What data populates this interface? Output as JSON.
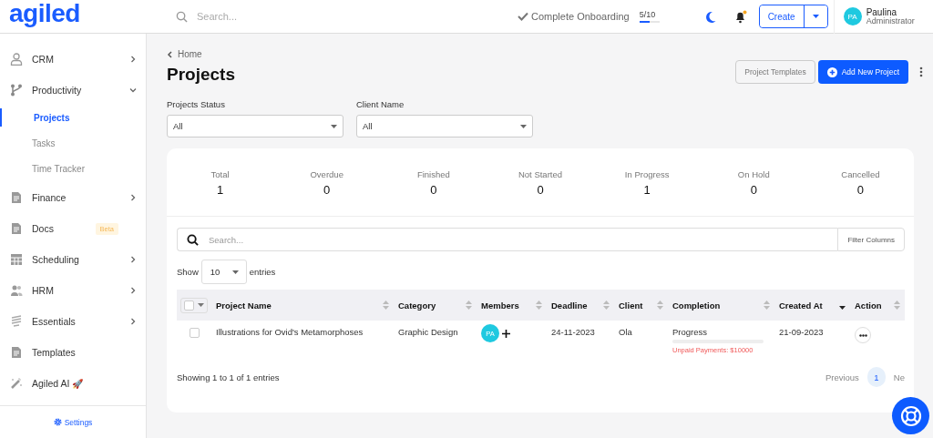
{
  "header": {
    "logo": "agiled",
    "search": {
      "placeholder": "Search..."
    },
    "onboarding": {
      "label": "Complete Onboarding",
      "count": "5/10",
      "level": 0.5
    },
    "notifications": {
      "unread": true
    },
    "create_button": "Create",
    "user": {
      "initials": "PA",
      "name": "Paulina",
      "role": "Administrator"
    }
  },
  "sidebar": {
    "items": [
      {
        "label": "CRM",
        "expanded": false,
        "selected": false
      },
      {
        "label": "Productivity",
        "expanded": true,
        "selected": false,
        "children": [
          {
            "label": "Projects",
            "selected": true
          },
          {
            "label": "Tasks",
            "selected": false
          },
          {
            "label": "Time Tracker",
            "selected": false
          }
        ]
      },
      {
        "label": "Finance",
        "expanded": false,
        "selected": false
      },
      {
        "label": "Docs",
        "badge": "Beta",
        "selected": false
      },
      {
        "label": "Scheduling",
        "expanded": false,
        "selected": false
      },
      {
        "label": "HRM",
        "expanded": false,
        "selected": false
      },
      {
        "label": "Essentials",
        "expanded": false,
        "selected": false
      },
      {
        "label": "Templates",
        "selected": false
      },
      {
        "label": "Agiled AI",
        "emoji": "🚀",
        "selected": false
      }
    ],
    "settings": "Settings"
  },
  "breadcrumb": "Home",
  "title": "Projects",
  "actions": {
    "templates": "Project Templates",
    "add": "Add New Project"
  },
  "filters": [
    {
      "label": "Projects Status",
      "value": "All"
    },
    {
      "label": "Client Name",
      "value": "All"
    }
  ],
  "stats": [
    {
      "label": "Total",
      "value": "1"
    },
    {
      "label": "Overdue",
      "value": "0"
    },
    {
      "label": "Finished",
      "value": "0"
    },
    {
      "label": "Not Started",
      "value": "0"
    },
    {
      "label": "In Progress",
      "value": "1"
    },
    {
      "label": "On Hold",
      "value": "0"
    },
    {
      "label": "Cancelled",
      "value": "0"
    }
  ],
  "table_search": {
    "placeholder": "Search..."
  },
  "filter_columns": "Filter Columns",
  "select_all": {
    "checked": false
  },
  "page_size": {
    "before": "Show",
    "value": "10",
    "after": "entries"
  },
  "table": {
    "columns": [
      {
        "label": "Project Name",
        "sorted": false
      },
      {
        "label": "Category",
        "sorted": false
      },
      {
        "label": "Members",
        "sorted": false
      },
      {
        "label": "Deadline",
        "sorted": false
      },
      {
        "label": "Client",
        "sorted": false
      },
      {
        "label": "Completion",
        "sorted": false
      },
      {
        "label": "Created At",
        "sorted": true
      },
      {
        "label": "Action",
        "sorted": false
      }
    ],
    "rows": [
      {
        "checked": false,
        "name": "Illustrations for Ovid's Metamorphoses",
        "category": "Graphic Design",
        "members": [
          "PA"
        ],
        "deadline": "24-11-2023",
        "client": "Ola",
        "completion": {
          "label": "Progress",
          "level": 0,
          "note": "Unpaid Payments: $10000"
        },
        "created": "21-09-2023"
      }
    ]
  },
  "footer": {
    "info": "Showing 1 to 1 of 1 entries",
    "previous": "Previous",
    "pages": [
      {
        "label": "1",
        "selected": true
      }
    ],
    "next": "Ne"
  }
}
